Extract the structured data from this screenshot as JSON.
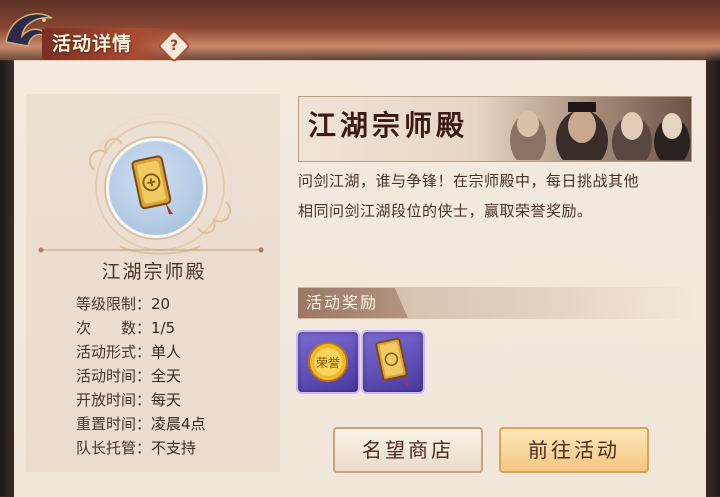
{
  "window": {
    "title": "活动详情",
    "help_symbol": "?"
  },
  "activity": {
    "name": "江湖宗师殿",
    "banner_title": "江湖宗师殿",
    "description_lines": [
      "问剑江湖，谁与争锋！在宗师殿中，每日挑战其他",
      "相同问剑江湖段位的侠士，赢取荣誉奖励。"
    ],
    "icon": "gold-token-icon"
  },
  "info": [
    {
      "label": "等级限制：",
      "value": "20"
    },
    {
      "label": "次　　数：",
      "value": "1/5"
    },
    {
      "label": "活动形式：",
      "value": "单人"
    },
    {
      "label": "活动时间：",
      "value": "全天"
    },
    {
      "label": "开放时间：",
      "value": "每天"
    },
    {
      "label": "重置时间：",
      "value": "凌晨4点"
    },
    {
      "label": "队长托管：",
      "value": "不支持"
    }
  ],
  "rewards": {
    "header": "活动奖励",
    "items": [
      {
        "icon": "honor-coin-icon",
        "coin_text": "荣誉"
      },
      {
        "icon": "gold-token-icon"
      }
    ]
  },
  "buttons": {
    "shop": "名望商店",
    "go": "前往活动"
  },
  "colors": {
    "panel_bg": "#f4eadf",
    "title_red": "#a84a33",
    "text_brown": "#4a3428",
    "go_button": "#f2c682",
    "reward_slot": "#5a49b8"
  }
}
